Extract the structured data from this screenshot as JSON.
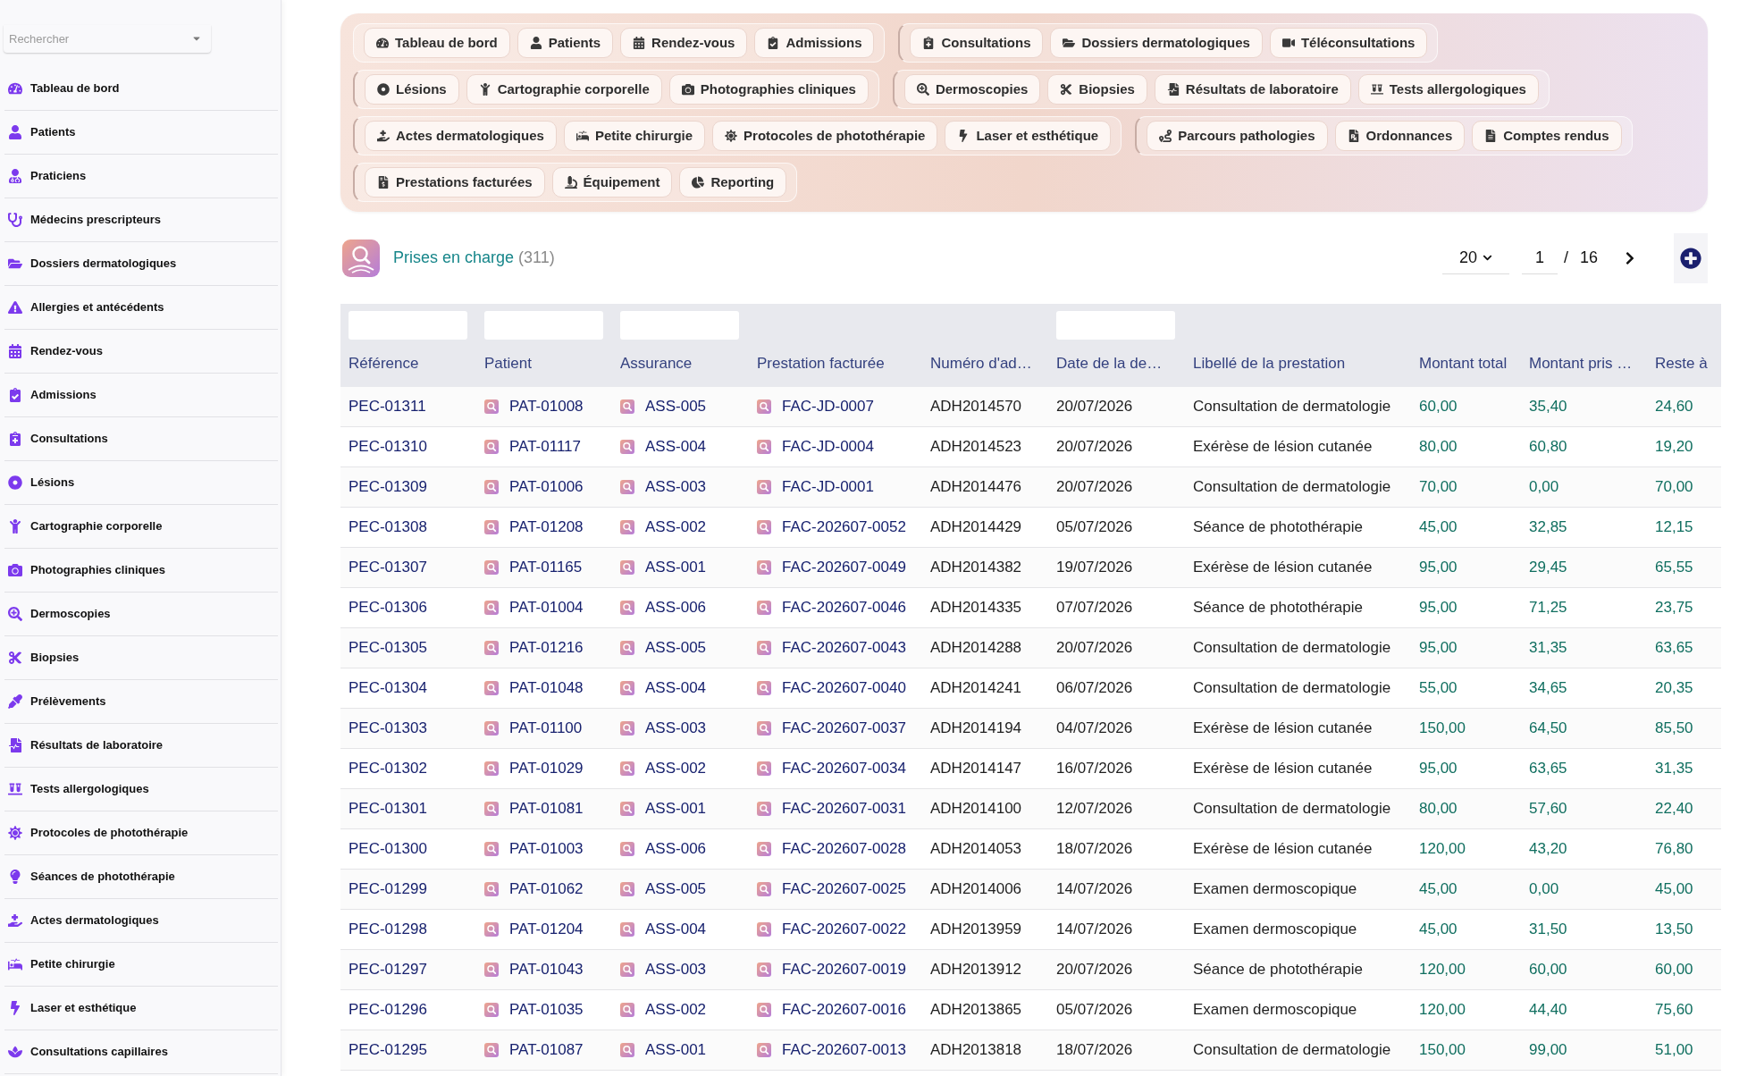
{
  "sidebar": {
    "search": {
      "placeholder": "Rechercher"
    },
    "items": [
      "Tableau de bord",
      "Patients",
      "Praticiens",
      "Médecins prescripteurs",
      "Dossiers dermatologiques",
      "Allergies et antécédents",
      "Rendez-vous",
      "Admissions",
      "Consultations",
      "Lésions",
      "Cartographie corporelle",
      "Photographies cliniques",
      "Dermoscopies",
      "Biopsies",
      "Prélèvements",
      "Résultats de laboratoire",
      "Tests allergologiques",
      "Protocoles de photothérapie",
      "Séances de photothérapie",
      "Actes dermatologiques",
      "Petite chirurgie",
      "Laser et esthétique",
      "Consultations capillaires"
    ]
  },
  "nav": {
    "rows": [
      {
        "groups": [
          {
            "items": [
              "Tableau de bord",
              "Patients",
              "Rendez-vous",
              "Admissions"
            ]
          },
          {
            "items": [
              "Consultations",
              "Dossiers dermatologiques",
              "Téléconsultations"
            ]
          }
        ]
      },
      {
        "groups": [
          {
            "items": [
              "Lésions",
              "Cartographie corporelle",
              "Photographies cliniques"
            ]
          },
          {
            "items": [
              "Dermoscopies",
              "Biopsies",
              "Résultats de laboratoire",
              "Tests allergologiques"
            ]
          }
        ]
      },
      {
        "groups": [
          {
            "items": [
              "Actes dermatologiques",
              "Petite chirurgie",
              "Protocoles de photothérapie",
              "Laser et esthétique"
            ]
          },
          {
            "items": [
              "Parcours pathologies",
              "Ordonnances",
              "Comptes rendus"
            ]
          }
        ]
      },
      {
        "groups": [
          {
            "items": [
              "Prestations facturées",
              "Équipement",
              "Reporting"
            ]
          }
        ]
      }
    ]
  },
  "header": {
    "title": "Prises en charge",
    "count": "(311)"
  },
  "pagination": {
    "page_size": "20",
    "page": "1",
    "separator": "/",
    "total_pages": "16"
  },
  "table": {
    "columns": [
      {
        "label": "Référence",
        "kind": "link",
        "filter": true
      },
      {
        "label": "Patient",
        "kind": "link_icon",
        "filter": true
      },
      {
        "label": "Assurance",
        "kind": "link_icon",
        "filter": true
      },
      {
        "label": "Prestation facturée",
        "kind": "link_icon",
        "filter": false
      },
      {
        "label": "Numéro d'ad…",
        "kind": "text",
        "filter": false
      },
      {
        "label": "Date de la de…",
        "kind": "text",
        "filter": true
      },
      {
        "label": "Libellé de la prestation",
        "kind": "text",
        "filter": false
      },
      {
        "label": "Montant total",
        "kind": "amount",
        "filter": false
      },
      {
        "label": "Montant pris …",
        "kind": "amount",
        "filter": false
      },
      {
        "label": "Reste à",
        "kind": "amount",
        "filter": false
      }
    ],
    "rows": [
      [
        "PEC-01311",
        "PAT-01008",
        "ASS-005",
        "FAC-JD-0007",
        "ADH2014570",
        "20/07/2026",
        "Consultation de dermatologie",
        "60,00",
        "35,40",
        "24,60"
      ],
      [
        "PEC-01310",
        "PAT-01117",
        "ASS-004",
        "FAC-JD-0004",
        "ADH2014523",
        "20/07/2026",
        "Exérèse de lésion cutanée",
        "80,00",
        "60,80",
        "19,20"
      ],
      [
        "PEC-01309",
        "PAT-01006",
        "ASS-003",
        "FAC-JD-0001",
        "ADH2014476",
        "20/07/2026",
        "Consultation de dermatologie",
        "70,00",
        "0,00",
        "70,00"
      ],
      [
        "PEC-01308",
        "PAT-01208",
        "ASS-002",
        "FAC-202607-0052",
        "ADH2014429",
        "05/07/2026",
        "Séance de photothérapie",
        "45,00",
        "32,85",
        "12,15"
      ],
      [
        "PEC-01307",
        "PAT-01165",
        "ASS-001",
        "FAC-202607-0049",
        "ADH2014382",
        "19/07/2026",
        "Exérèse de lésion cutanée",
        "95,00",
        "29,45",
        "65,55"
      ],
      [
        "PEC-01306",
        "PAT-01004",
        "ASS-006",
        "FAC-202607-0046",
        "ADH2014335",
        "07/07/2026",
        "Séance de photothérapie",
        "95,00",
        "71,25",
        "23,75"
      ],
      [
        "PEC-01305",
        "PAT-01216",
        "ASS-005",
        "FAC-202607-0043",
        "ADH2014288",
        "20/07/2026",
        "Consultation de dermatologie",
        "95,00",
        "31,35",
        "63,65"
      ],
      [
        "PEC-01304",
        "PAT-01048",
        "ASS-004",
        "FAC-202607-0040",
        "ADH2014241",
        "06/07/2026",
        "Consultation de dermatologie",
        "55,00",
        "34,65",
        "20,35"
      ],
      [
        "PEC-01303",
        "PAT-01100",
        "ASS-003",
        "FAC-202607-0037",
        "ADH2014194",
        "04/07/2026",
        "Exérèse de lésion cutanée",
        "150,00",
        "64,50",
        "85,50"
      ],
      [
        "PEC-01302",
        "PAT-01029",
        "ASS-002",
        "FAC-202607-0034",
        "ADH2014147",
        "16/07/2026",
        "Exérèse de lésion cutanée",
        "95,00",
        "63,65",
        "31,35"
      ],
      [
        "PEC-01301",
        "PAT-01081",
        "ASS-001",
        "FAC-202607-0031",
        "ADH2014100",
        "12/07/2026",
        "Consultation de dermatologie",
        "80,00",
        "57,60",
        "22,40"
      ],
      [
        "PEC-01300",
        "PAT-01003",
        "ASS-006",
        "FAC-202607-0028",
        "ADH2014053",
        "18/07/2026",
        "Exérèse de lésion cutanée",
        "120,00",
        "43,20",
        "76,80"
      ],
      [
        "PEC-01299",
        "PAT-01062",
        "ASS-005",
        "FAC-202607-0025",
        "ADH2014006",
        "14/07/2026",
        "Examen dermoscopique",
        "45,00",
        "0,00",
        "45,00"
      ],
      [
        "PEC-01298",
        "PAT-01204",
        "ASS-004",
        "FAC-202607-0022",
        "ADH2013959",
        "14/07/2026",
        "Examen dermoscopique",
        "45,00",
        "31,50",
        "13,50"
      ],
      [
        "PEC-01297",
        "PAT-01043",
        "ASS-003",
        "FAC-202607-0019",
        "ADH2013912",
        "20/07/2026",
        "Séance de photothérapie",
        "120,00",
        "60,00",
        "60,00"
      ],
      [
        "PEC-01296",
        "PAT-01035",
        "ASS-002",
        "FAC-202607-0016",
        "ADH2013865",
        "05/07/2026",
        "Examen dermoscopique",
        "120,00",
        "44,40",
        "75,60"
      ],
      [
        "PEC-01295",
        "PAT-01087",
        "ASS-001",
        "FAC-202607-0013",
        "ADH2013818",
        "18/07/2026",
        "Consultation de dermatologie",
        "150,00",
        "99,00",
        "51,00"
      ]
    ]
  }
}
